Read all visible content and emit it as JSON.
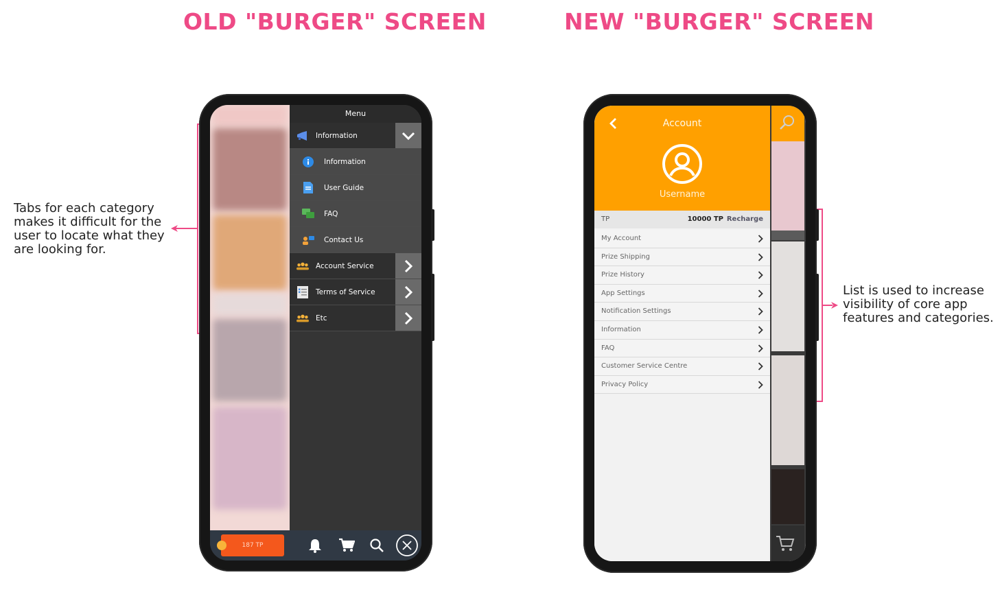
{
  "headings": {
    "old": "OLD \"BURGER\" SCREEN",
    "new": "NEW \"BURGER\" SCREEN"
  },
  "annotations": {
    "left": "Tabs for each category makes it difficult for the user to locate what they are looking for.",
    "right": "List is used to increase visibility of core app features and categories."
  },
  "colors": {
    "accent_pink": "#ee4a86",
    "account_orange": "#ffa000",
    "old_menu_bg": "#353535",
    "tp_button": "#f4581c"
  },
  "old_screen": {
    "menu_title": "Menu",
    "items": [
      {
        "label": "Information",
        "icon": "megaphone-icon",
        "level": "category",
        "arrow": "chevron-down-icon"
      },
      {
        "label": "Information",
        "icon": "info-icon",
        "level": "sub"
      },
      {
        "label": "User Guide",
        "icon": "document-icon",
        "level": "sub"
      },
      {
        "label": "FAQ",
        "icon": "chat-icon",
        "level": "sub"
      },
      {
        "label": "Contact Us",
        "icon": "contact-icon",
        "level": "sub"
      },
      {
        "label": "Account Service",
        "icon": "group-icon",
        "level": "category",
        "arrow": "chevron-right-icon"
      },
      {
        "label": "Terms of Service",
        "icon": "checklist-icon",
        "level": "category",
        "arrow": "chevron-right-icon"
      },
      {
        "label": "Etc",
        "icon": "group-icon",
        "level": "category",
        "arrow": "chevron-right-icon"
      }
    ],
    "bottom_bar": {
      "tp_label": "187 TP",
      "icons": [
        "bell-icon",
        "cart-icon",
        "search-icon",
        "close-icon"
      ]
    }
  },
  "new_screen": {
    "title": "Account",
    "username": "Username",
    "tp_row": {
      "label": "TP",
      "value": "10000 TP",
      "action": "Recharge"
    },
    "list": [
      "My Account",
      "Prize Shipping",
      "Prize History",
      "App Settings",
      "Notification Settings",
      "Information",
      "FAQ",
      "Customer Service Centre",
      "Privacy Policy"
    ]
  }
}
